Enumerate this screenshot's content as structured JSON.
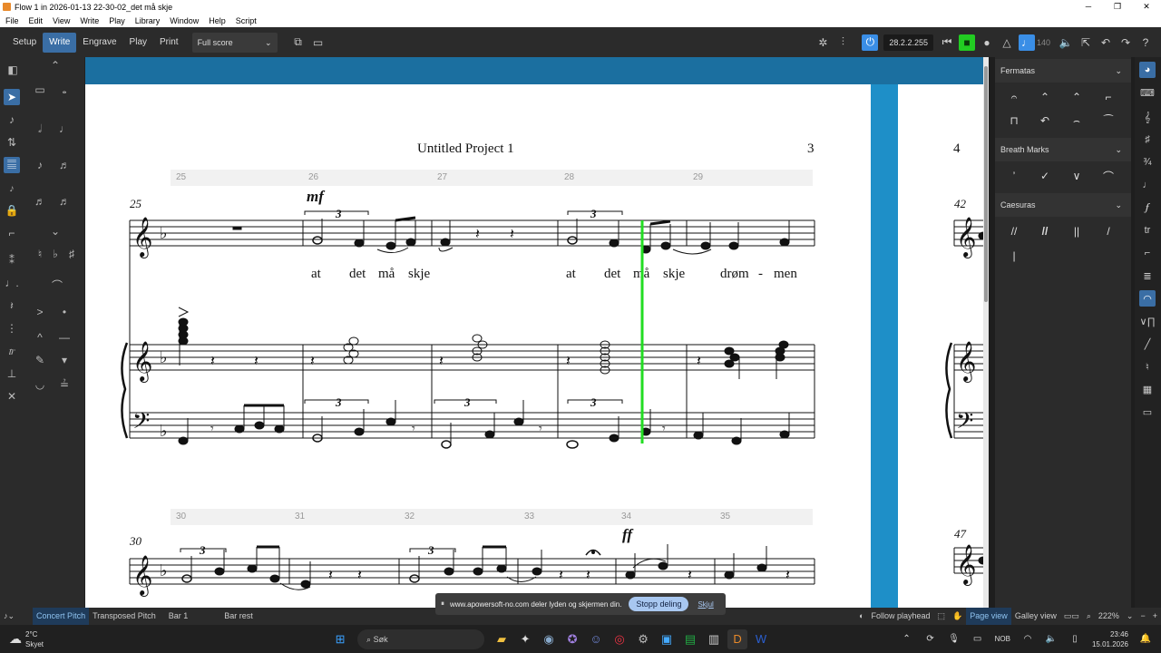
{
  "window": {
    "title": "Flow 1 in 2026-01-13 22-30-02_det må skje",
    "minimize": "─",
    "maximize": "❐",
    "close": "✕"
  },
  "menu": [
    "File",
    "Edit",
    "View",
    "Write",
    "Play",
    "Library",
    "Window",
    "Help",
    "Script"
  ],
  "modes": [
    "Setup",
    "Write",
    "Engrave",
    "Play",
    "Print"
  ],
  "active_mode": "Write",
  "layout_select": "Full score",
  "transport": {
    "time": "28.2.2.255",
    "tempo": "140"
  },
  "score": {
    "page_title": "Untitled Project 1",
    "page_number": "3",
    "next_page_number": "4",
    "system1_bar_numbers": [
      "25",
      "26",
      "27",
      "28",
      "29"
    ],
    "system2_bar_numbers": [
      "30",
      "31",
      "32",
      "33",
      "34",
      "35"
    ],
    "system1_start": "25",
    "system2_start": "30",
    "next_page_bars": [
      "42",
      "47"
    ],
    "dynamics": {
      "mf": "mf",
      "ff": "ff"
    },
    "tuplet": "3",
    "lyrics": [
      "at",
      "det",
      "må",
      "skje",
      "at",
      "det",
      "må",
      "skje",
      "drøm",
      "-",
      "men"
    ]
  },
  "panel": {
    "sections": [
      {
        "title": "Fermatas",
        "items": [
          "𝄐",
          "⌃",
          "⌃",
          "⌐",
          "⊓",
          "↶",
          "⌢",
          "⁀"
        ]
      },
      {
        "title": "Breath Marks",
        "items": [
          "’",
          "✓",
          "∨",
          "⌒"
        ]
      },
      {
        "title": "Caesuras",
        "items": [
          "//",
          "//",
          "||",
          "/",
          "|"
        ]
      }
    ]
  },
  "status": {
    "concert_pitch": "Concert Pitch",
    "transposed_pitch": "Transposed Pitch",
    "bar": "Bar 1",
    "bar_rest": "Bar rest",
    "follow_playhead": "Follow playhead",
    "page_view": "Page view",
    "galley_view": "Galley view",
    "zoom": "222%"
  },
  "notification": {
    "text": "www.apowersoft-no.com deler lyden og skjermen din.",
    "stop": "Stopp deling",
    "hide": "Skjul"
  },
  "taskbar": {
    "weather_temp": "2°C",
    "weather_desc": "Skyet",
    "search": "Søk",
    "lang": "NOB",
    "time": "23:46",
    "date": "15.01.2026"
  },
  "colors": {
    "accent": "#3a6ea5",
    "playhead": "#22dd22",
    "canvas": "#1e8fc8"
  }
}
